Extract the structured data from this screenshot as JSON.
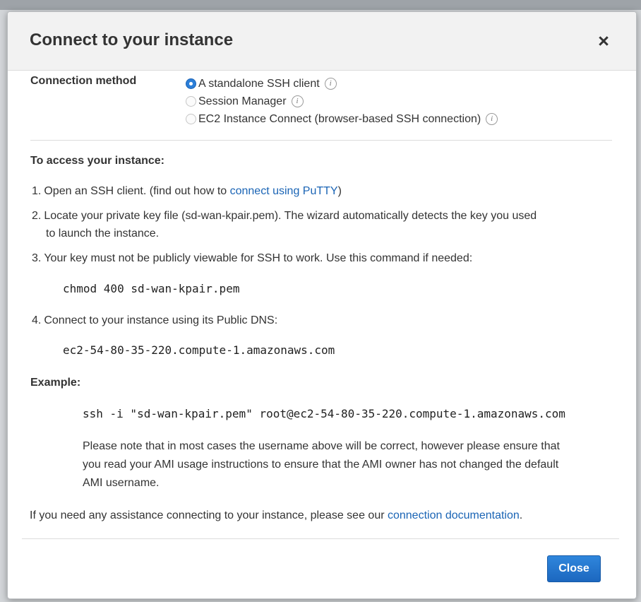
{
  "dialog": {
    "title": "Connect to your instance",
    "close_symbol": "×"
  },
  "connection_method": {
    "label": "Connection method",
    "options": [
      {
        "label": "A standalone SSH client",
        "selected": true
      },
      {
        "label": "Session Manager",
        "selected": false
      },
      {
        "label": "EC2 Instance Connect (browser-based SSH connection)",
        "selected": false
      }
    ],
    "info_glyph": "i"
  },
  "access": {
    "heading": "To access your instance:",
    "steps": [
      {
        "num": "1.",
        "text": "Open an SSH client. (find out how to ",
        "link": "connect using PuTTY",
        "after": ")"
      },
      {
        "num": "2.",
        "line1": "Locate your private key file (sd-wan-kpair.pem). The wizard automatically detects the key you used",
        "line2": "to launch the instance."
      },
      {
        "num": "3.",
        "text": "Your key must not be publicly viewable for SSH to work. Use this command if needed:"
      },
      {
        "num": "4.",
        "text": "Connect to your instance using its Public DNS:"
      }
    ],
    "chmod_command": "chmod 400 sd-wan-kpair.pem",
    "public_dns": "ec2-54-80-35-220.compute-1.amazonaws.com"
  },
  "example": {
    "heading": "Example:",
    "command": "ssh -i \"sd-wan-kpair.pem\" root@ec2-54-80-35-220.compute-1.amazonaws.com",
    "note_line1": "Please note that in most cases the username above will be correct, however please ensure that",
    "note_line2": "you read your AMI usage instructions to ensure that the AMI owner has not changed the default",
    "note_line3": "AMI username."
  },
  "assistance": {
    "text": "If you need any assistance connecting to your instance, please see our ",
    "link": "connection documentation",
    "after": "."
  },
  "footer": {
    "close_label": "Close"
  },
  "colors": {
    "link": "#1a64b5",
    "primary_button": "#1c67bf",
    "radio_selected": "#2b7ed8"
  }
}
